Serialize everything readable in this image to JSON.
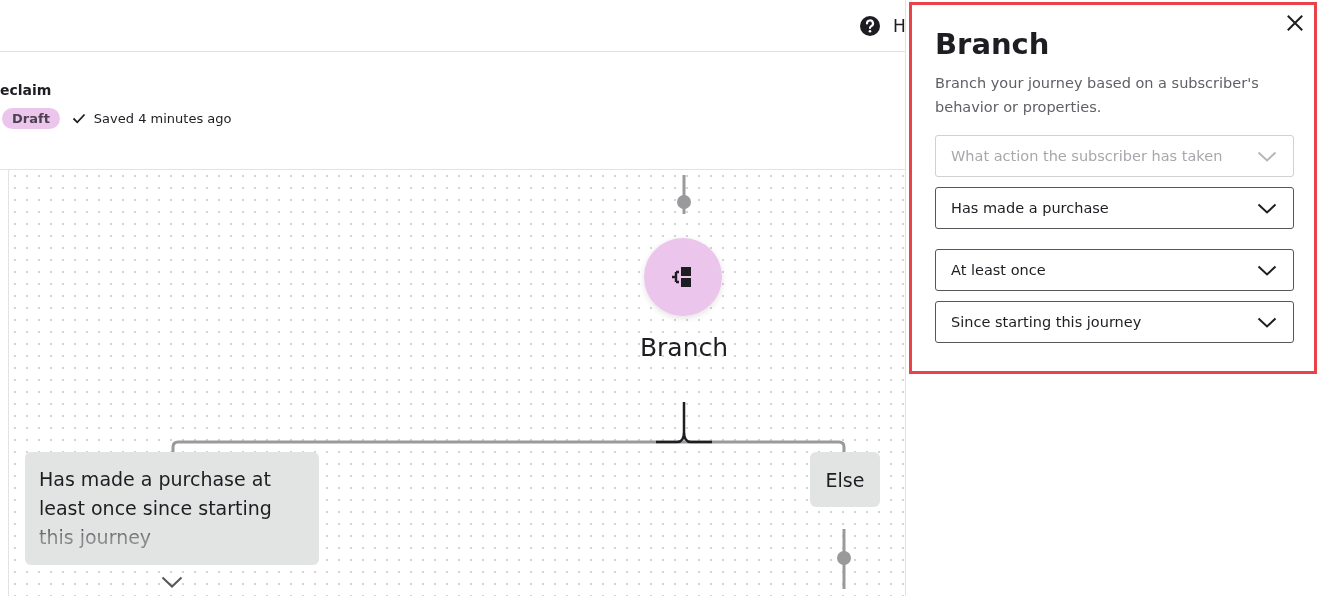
{
  "top_bar": {
    "help_label": "H"
  },
  "journey": {
    "title": "eclaim",
    "status": "Draft",
    "saved": "Saved 4 minutes ago"
  },
  "canvas": {
    "node": {
      "label": "Branch"
    },
    "branches": [
      {
        "kind": "condition",
        "label": "Has made a purchase at least once since starting this journey"
      },
      {
        "kind": "else",
        "label": "Else"
      }
    ]
  },
  "panel": {
    "title": "Branch",
    "description": "Branch your journey based on a subscriber's behavior or properties.",
    "dropdowns": [
      {
        "placeholder": "What action the subscriber has taken",
        "disabled": true
      },
      {
        "value": "Has made a purchase",
        "disabled": false
      },
      {
        "value": "At least once",
        "disabled": false
      },
      {
        "value": "Since starting this journey",
        "disabled": false
      }
    ]
  }
}
